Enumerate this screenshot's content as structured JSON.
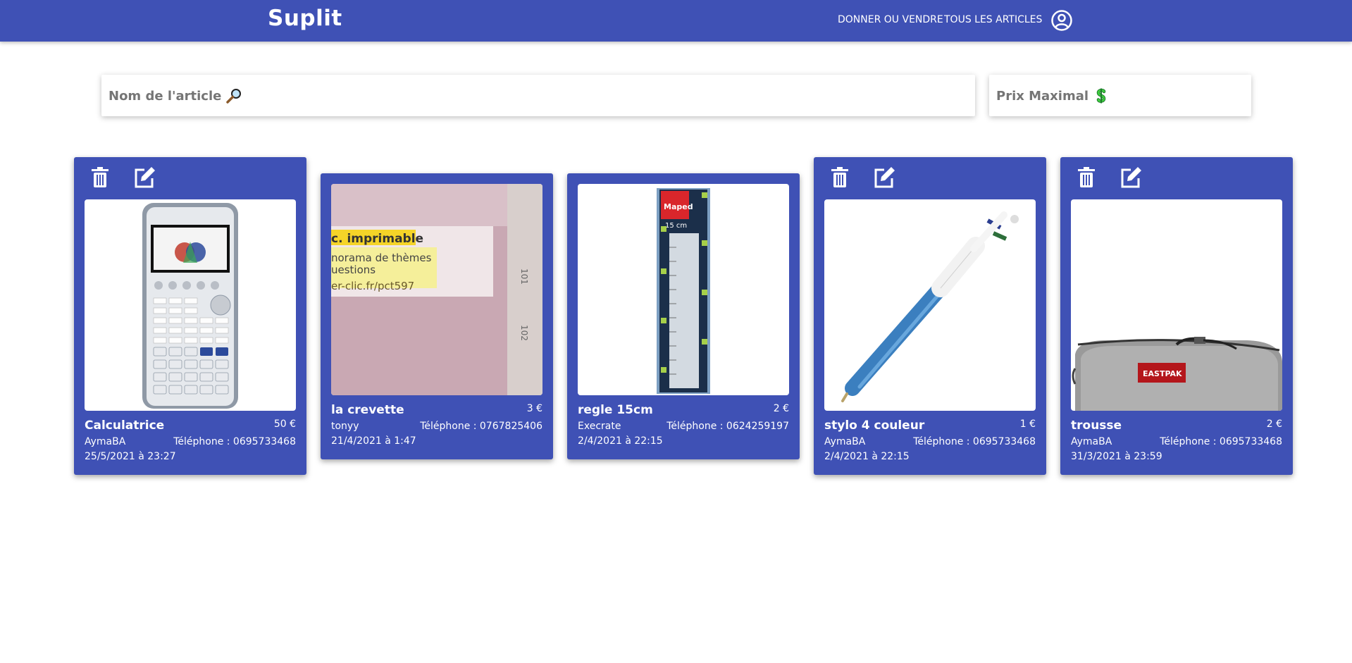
{
  "header": {
    "brand": "Suplit",
    "nav": {
      "donner_label": "DONNER OU VENDRE",
      "tous_label": "TOUS LES ARTICLES"
    },
    "account_icon": "account-circle-icon"
  },
  "search": {
    "name_placeholder": "Nom de l'article",
    "name_icon": "magnifier-icon",
    "price_placeholder": "Prix Maximal",
    "price_icon": "dollar-icon"
  },
  "colors": {
    "primary": "#3f51b5",
    "text_on_primary": "#ffffff"
  },
  "cards": [
    {
      "title": "Calculatrice",
      "price": "50 €",
      "seller": "AymaBA",
      "phone": "Téléphone : 0695733468",
      "date": "25/5/2021 à 23:27",
      "image": "calculator-photo",
      "owner_actions": true
    },
    {
      "title": "la crevette",
      "price": "3 €",
      "seller": "tonyy",
      "phone": "Téléphone : 0767825406",
      "date": "21/4/2021 à 1:47",
      "image": "pink-folder-photo",
      "owner_actions": false
    },
    {
      "title": "regle 15cm",
      "price": "2 €",
      "seller": "Execrate",
      "phone": "Téléphone : 0624259197",
      "date": "2/4/2021 à 22:15",
      "image": "ruler-photo",
      "owner_actions": false
    },
    {
      "title": "stylo 4 couleur",
      "price": "1 €",
      "seller": "AymaBA",
      "phone": "Téléphone : 0695733468",
      "date": "2/4/2021 à 22:15",
      "image": "pen-photo",
      "owner_actions": true
    },
    {
      "title": "trousse",
      "price": "2 €",
      "seller": "AymaBA",
      "phone": "Téléphone : 0695733468",
      "date": "31/3/2021 à 23:59",
      "image": "pencil-case-photo",
      "owner_actions": true
    }
  ]
}
